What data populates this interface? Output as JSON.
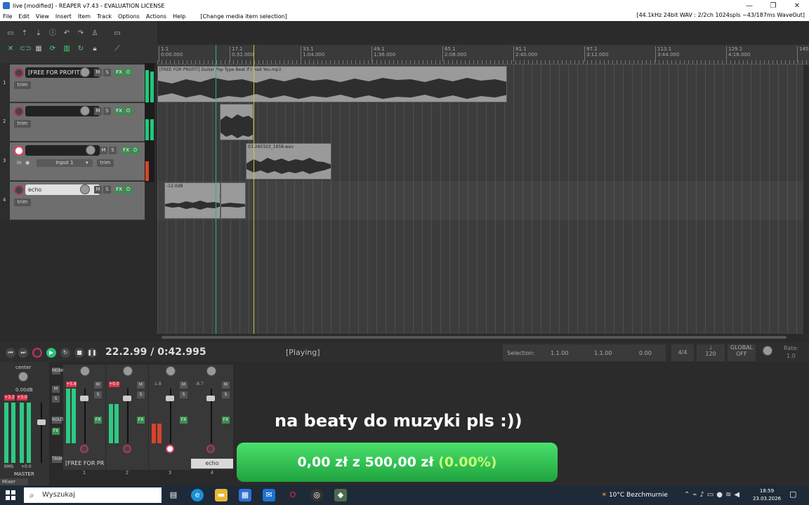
{
  "window": {
    "title": "live [modified] - REAPER v7.43 - EVALUATION LICENSE",
    "controls": [
      "—",
      "❐",
      "✕"
    ]
  },
  "menu": {
    "items": [
      "File",
      "Edit",
      "View",
      "Insert",
      "Item",
      "Track",
      "Options",
      "Actions",
      "Help"
    ],
    "last_action": "[Change media item selection]",
    "audio_info": "[44.1kHz 24bit WAV : 2/2ch 1024spls ~43/187ms WaveOut]"
  },
  "ruler": {
    "markers": [
      {
        "bar": "1.1",
        "time": "0:00.000"
      },
      {
        "bar": "17.1",
        "time": "0:32.000"
      },
      {
        "bar": "33.1",
        "time": "1:04.000"
      },
      {
        "bar": "49.1",
        "time": "1:36.000"
      },
      {
        "bar": "65.1",
        "time": "2:08.000"
      },
      {
        "bar": "81.1",
        "time": "2:40.000"
      },
      {
        "bar": "97.1",
        "time": "3:12.000"
      },
      {
        "bar": "113.1",
        "time": "3:44.000"
      },
      {
        "bar": "129.1",
        "time": "4:16.000"
      },
      {
        "bar": "145",
        "time": ""
      }
    ]
  },
  "tracks": [
    {
      "num": "1",
      "name": "[FREE FOR PROFIT]",
      "env": "trim"
    },
    {
      "num": "2",
      "name": "",
      "env": "trim"
    },
    {
      "num": "3",
      "name": "",
      "in_label": "in",
      "input": "Input 1",
      "env": "trim"
    },
    {
      "num": "4",
      "name": "echo",
      "env": "trim"
    }
  ],
  "track_buttons": {
    "mute": "M",
    "solo": "S",
    "fx": "FX"
  },
  "items": [
    {
      "label": "[FREE FOR PROFIT] Guitar Pop Type Beat If I Had You.mp3"
    },
    {
      "label": ""
    },
    {
      "label": "03-260323_1858.wav"
    },
    {
      "label": "-12.0dB"
    },
    {
      "label": ""
    }
  ],
  "transport": {
    "time": "22.2.99 / 0:42.995",
    "state": "[Playing]",
    "selection_label": "Selection:",
    "sel_start": "1.1.00",
    "sel_end": "1.1.00",
    "sel_len": "0.00",
    "timesig": "4/4",
    "bpm": "120",
    "global_label": "GLOBAL",
    "global_value": "OFF",
    "rate_label": "Rate:",
    "rate_value": "1.0"
  },
  "mixer": {
    "master_label": "MASTER",
    "mixer_tab": "Mixer",
    "center": "center",
    "master_db": "0.00dB",
    "master_peaks": [
      "+3.3",
      "+3.0"
    ],
    "master_buttons": [
      "MONO",
      "M",
      "S",
      "ROUTE",
      "FX",
      "TRIM"
    ],
    "rms": "RMS",
    "rms_value": "+0.0",
    "strips": [
      {
        "num": "1",
        "name": "[FREE FOR PR",
        "peak": "+5.8"
      },
      {
        "num": "2",
        "name": "",
        "peak": "+0.0"
      },
      {
        "num": "3",
        "name": "",
        "peak": "-1.8"
      },
      {
        "num": "4",
        "name": "echo",
        "peak": "-8.7"
      }
    ]
  },
  "overlay": {
    "message": "na beaty do muzyki pls :))",
    "donation_current": "0,00 zł",
    "donation_sep": "z",
    "donation_goal": "500,00 zł",
    "donation_pct": "(0.00%)"
  },
  "taskbar": {
    "search": "Wyszukaj",
    "weather": "10°C  Bezchmurnie",
    "time": "18:59",
    "date": "23.03.2026"
  },
  "colors": {
    "accent_green": "#27c27a",
    "rec_red": "#c0395e",
    "donation_green": "#2fbf4a"
  }
}
